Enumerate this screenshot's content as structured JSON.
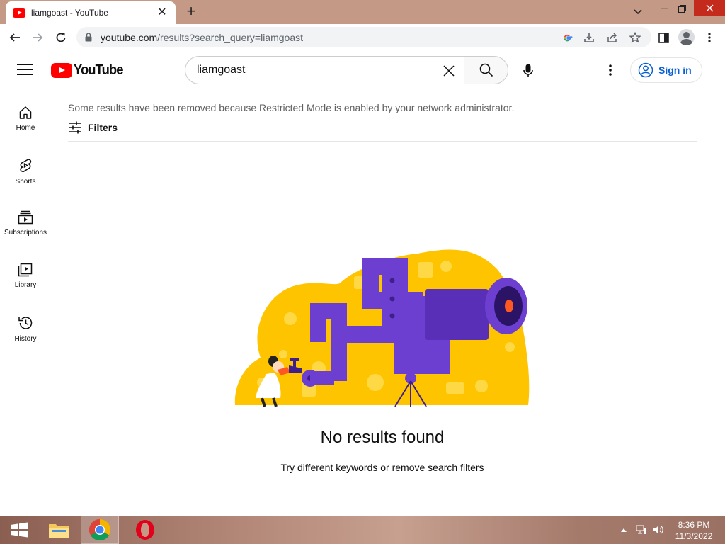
{
  "browser": {
    "tab_title": "liamgoast - YouTube",
    "tab_close": "✕",
    "new_tab": "+",
    "url_host": "youtube.com",
    "url_path": "/results?search_query=liamgoast"
  },
  "youtube": {
    "wordmark": "YouTube",
    "search_query": "liamgoast",
    "signin_label": "Sign in"
  },
  "guide": {
    "items": [
      {
        "label": "Home",
        "icon": "home-icon"
      },
      {
        "label": "Shorts",
        "icon": "shorts-icon"
      },
      {
        "label": "Subscriptions",
        "icon": "subscriptions-icon"
      },
      {
        "label": "Library",
        "icon": "library-icon"
      },
      {
        "label": "History",
        "icon": "history-icon"
      }
    ]
  },
  "results": {
    "restricted_notice": "Some results have been removed because Restricted Mode is enabled by your network administrator.",
    "filters_label": "Filters",
    "empty_title": "No results found",
    "empty_subtitle": "Try different keywords or remove search filters"
  },
  "taskbar": {
    "time": "8:36 PM",
    "date": "11/3/2022"
  },
  "colors": {
    "youtube_red": "#ff0000",
    "link_blue": "#065fd4",
    "illustration_yellow": "#ffc400",
    "illustration_purple": "#6c3fd1"
  }
}
